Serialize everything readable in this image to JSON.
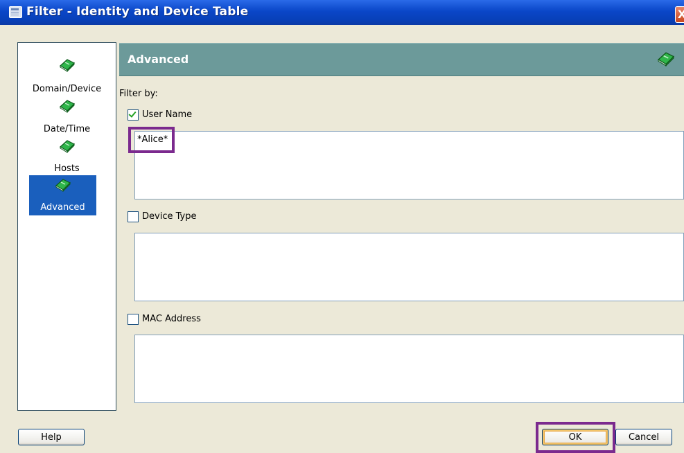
{
  "window": {
    "title": "Filter - Identity and Device Table",
    "close_label": "X"
  },
  "nav": {
    "items": [
      {
        "label": "Domain/Device",
        "selected": false
      },
      {
        "label": "Date/Time",
        "selected": false
      },
      {
        "label": "Hosts",
        "selected": false
      },
      {
        "label": "Advanced",
        "selected": true
      }
    ]
  },
  "panel": {
    "header": "Advanced",
    "filter_by_label": "Filter by:",
    "fields": [
      {
        "label": "User Name",
        "checked": true,
        "value": "*Alice*"
      },
      {
        "label": "Device Type",
        "checked": false,
        "value": ""
      },
      {
        "label": "MAC Address",
        "checked": false,
        "value": ""
      }
    ]
  },
  "buttons": {
    "help": "Help",
    "ok": "OK",
    "cancel": "Cancel"
  },
  "colors": {
    "titlebar": "#0a46c8",
    "header": "#6c9a9a",
    "selected": "#1a5fbd",
    "highlight": "#7b2a8e",
    "book": "#2fb54a"
  },
  "icons": {
    "title": "window-app-icon",
    "nav": "green-book-icon",
    "header": "green-book-icon"
  }
}
